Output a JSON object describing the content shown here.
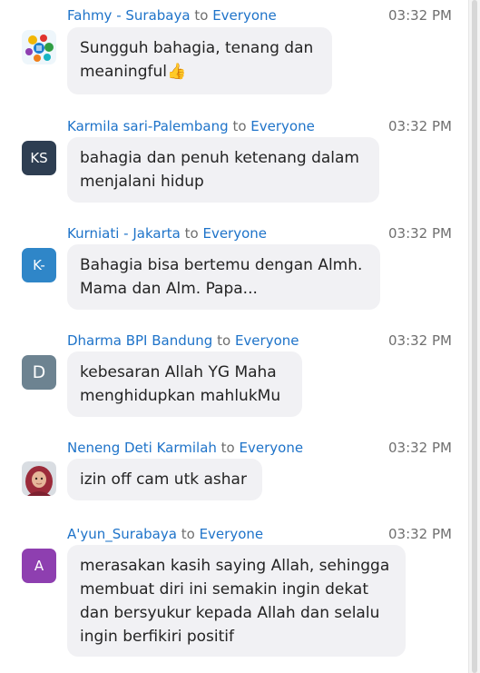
{
  "chat": {
    "messages": [
      {
        "sender": "Fahmy - Surabaya",
        "to_label": "to",
        "recipient": "Everyone",
        "time": "03:32 PM",
        "avatar_icon": "colorful-logo-icon",
        "lines": [
          "Sungguh bahagia, tenang dan",
          "meaningful"
        ],
        "emoji": "👍"
      },
      {
        "sender": "Karmila sari-Palembang",
        "to_label": "to",
        "recipient": "Everyone",
        "time": "03:32 PM",
        "avatar_text": "KS",
        "avatar_color": "#2e3e52",
        "lines": [
          "bahagia dan penuh ketenang dalam",
          "menjalani hidup"
        ]
      },
      {
        "sender": "Kurniati - Jakarta",
        "to_label": "to",
        "recipient": "Everyone",
        "time": "03:32 PM",
        "avatar_text": "K-",
        "avatar_color": "#2f86c8",
        "lines": [
          "Bahagia bisa bertemu dengan Almh.",
          "Mama dan Alm. Papa..."
        ]
      },
      {
        "sender": "Dharma BPI Bandung",
        "to_label": "to",
        "recipient": "Everyone",
        "time": "03:32 PM",
        "avatar_text": "D",
        "avatar_color": "#6d8391",
        "lines": [
          "kebesaran Allah YG Maha",
          "menghidupkan mahlukMu"
        ]
      },
      {
        "sender": "Neneng Deti Karmilah",
        "to_label": "to",
        "recipient": "Everyone",
        "time": "03:32 PM",
        "avatar_icon": "user-photo-icon",
        "lines": [
          "izin off cam utk ashar"
        ]
      },
      {
        "sender": "A'yun_Surabaya",
        "to_label": "to",
        "recipient": "Everyone",
        "time": "03:32 PM",
        "avatar_text": "A",
        "avatar_color": "#8e3fb0",
        "lines": [
          "merasakan kasih saying Allah, sehingga",
          "membuat diri ini semakin ingin dekat",
          "dan bersyukur kepada Allah dan selalu",
          "ingin berfikiri positif"
        ]
      }
    ]
  }
}
